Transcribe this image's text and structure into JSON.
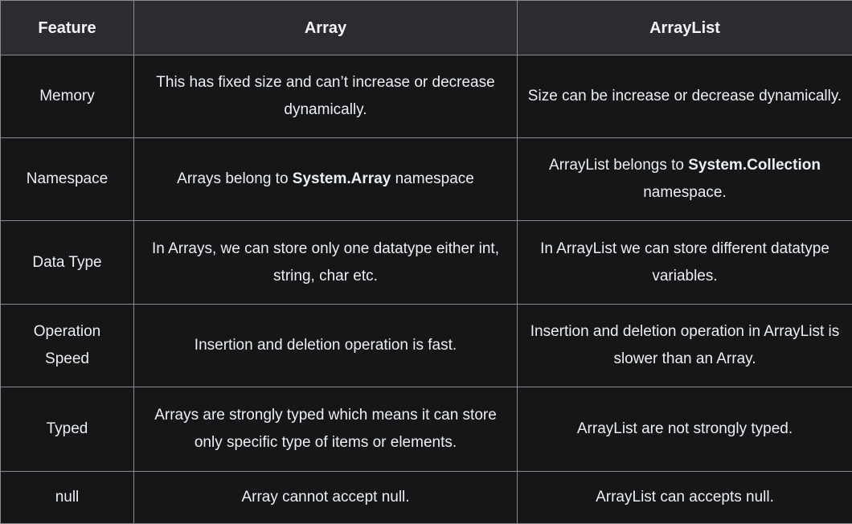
{
  "header": {
    "col1": "Feature",
    "col2": "Array",
    "col3": "ArrayList"
  },
  "rows": [
    {
      "feature": "Memory",
      "array": "This has fixed size and can’t increase or decrease dynamically.",
      "arraylist": "Size can be increase or decrease dynamically."
    },
    {
      "feature": "Namespace",
      "array_pre": "Arrays belong to ",
      "array_bold": "System.Array",
      "array_post": " namespace",
      "arraylist_pre": "ArrayList belongs to ",
      "arraylist_bold": "System.Collection",
      "arraylist_post": " namespace."
    },
    {
      "feature": "Data Type",
      "array": "In Arrays, we can store only one datatype either int, string, char etc.",
      "arraylist": "In ArrayList we can store different datatype variables."
    },
    {
      "feature": "Operation Speed",
      "array": "Insertion and deletion operation is fast.",
      "arraylist": "Insertion and deletion operation in ArrayList is slower than an Array."
    },
    {
      "feature": "Typed",
      "array": "Arrays are strongly typed which means it can store only specific type of items or elements.",
      "arraylist": "ArrayList are not strongly typed."
    },
    {
      "feature": "null",
      "array": "Array cannot accept null.",
      "arraylist": "ArrayList can accepts null."
    }
  ],
  "colors": {
    "header_bg": "#2b2c30",
    "cell_bg": "#151618",
    "border": "#8a8c91",
    "text": "#eceff2"
  }
}
